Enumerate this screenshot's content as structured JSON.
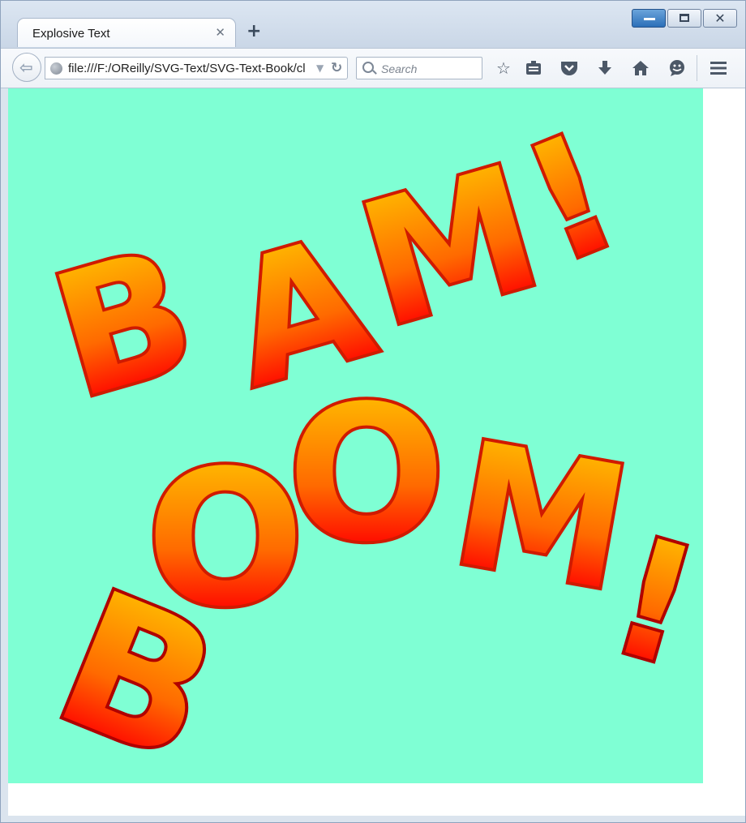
{
  "window": {
    "minimize": "minimize",
    "maximize": "maximize",
    "close": "close"
  },
  "tab": {
    "title": "Explosive Text",
    "close_glyph": "✕",
    "new_tab_glyph": "+"
  },
  "nav": {
    "back_glyph": "⇦",
    "url": "file:///F:/OReilly/SVG-Text/SVG-Text-Book/cl",
    "reload_glyph": "↻",
    "search_placeholder": "Search"
  },
  "toolbar_icons": [
    "star-icon",
    "reading-list-icon",
    "pocket-icon",
    "download-icon",
    "home-icon",
    "chat-icon",
    "menu-icon"
  ],
  "svg": {
    "background": "#7fffd4",
    "words": [
      {
        "word": "BAM!",
        "letters": [
          "B",
          "A",
          "M",
          "!"
        ]
      },
      {
        "word": "BOOM!",
        "letters": [
          "B",
          "O",
          "O",
          "M",
          "!"
        ]
      }
    ],
    "gradient": [
      "#ffd000",
      "#ff8000",
      "#ff0000",
      "#b80000"
    ],
    "stroke": "#d01a00"
  }
}
